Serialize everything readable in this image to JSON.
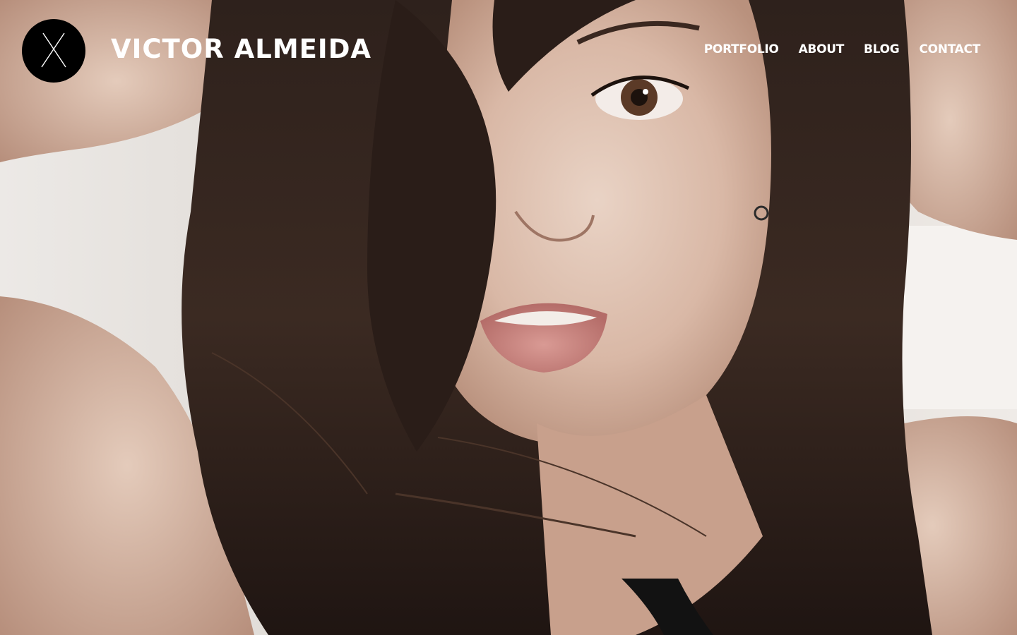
{
  "header": {
    "logo_icon": "x-monogram-icon",
    "site_title": "VICTOR ALMEIDA"
  },
  "nav": {
    "items": [
      {
        "label": "PORTFOLIO"
      },
      {
        "label": "ABOUT"
      },
      {
        "label": "BLOG"
      },
      {
        "label": "CONTACT"
      }
    ]
  },
  "hero": {
    "image": "portrait-photo"
  },
  "colors": {
    "text": "#ffffff",
    "logo_bg": "#000000",
    "background": "#e9e5e1"
  }
}
